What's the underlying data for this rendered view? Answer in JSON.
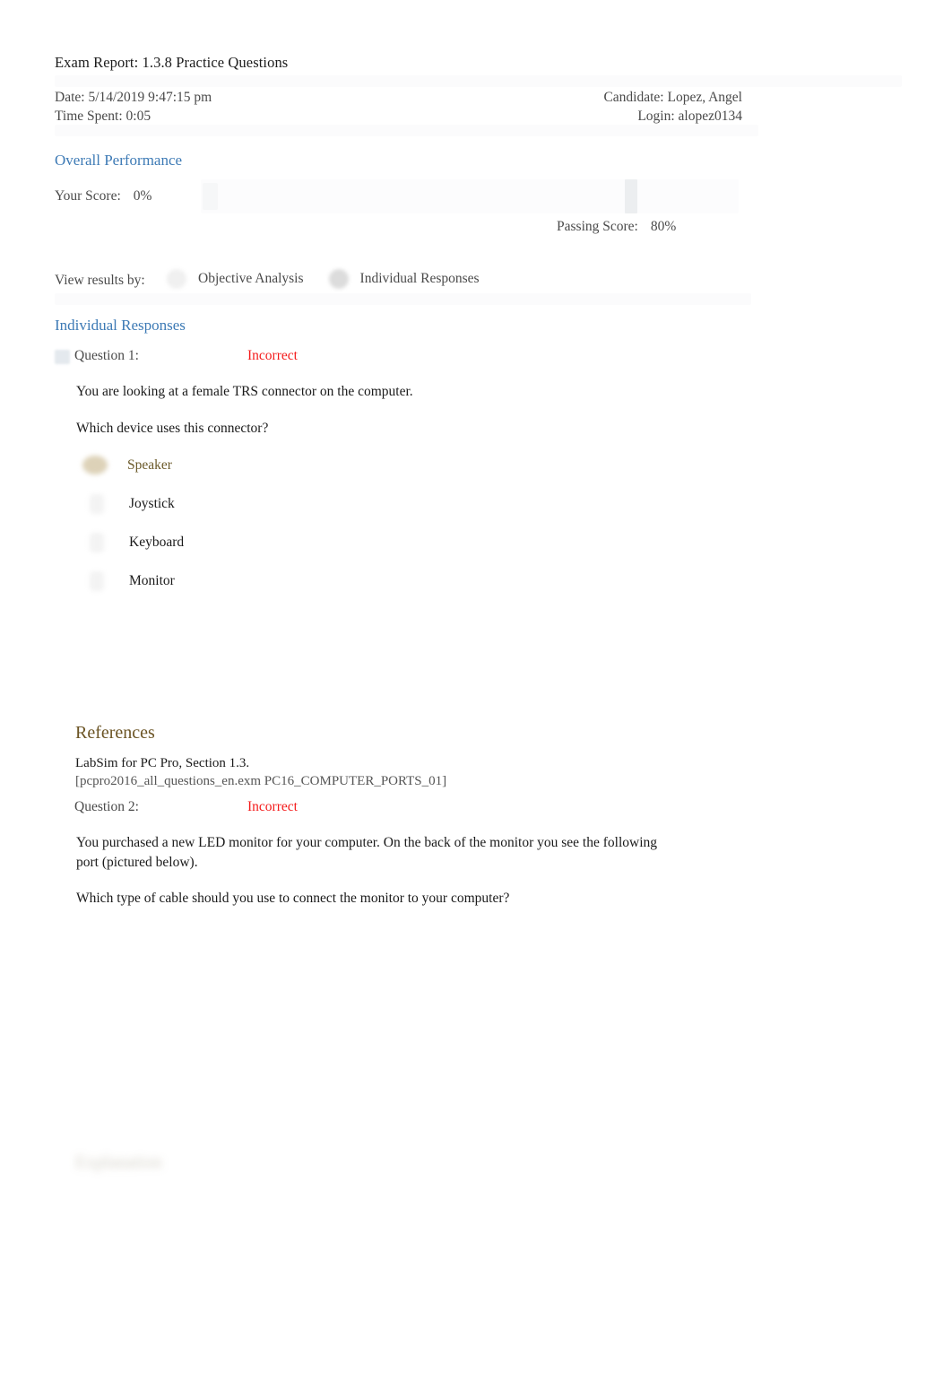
{
  "report": {
    "title": "Exam Report: 1.3.8 Practice Questions",
    "date_line": "Date: 5/14/2019 9:47:15 pm",
    "time_spent_line": "Time Spent: 0:05",
    "candidate_line": "Candidate: Lopez, Angel",
    "login_line": "Login: alopez0134"
  },
  "overall_performance": {
    "heading": "Overall Performance",
    "your_score_label": "Your Score:",
    "your_score_value": "0%",
    "passing_score_label": "Passing Score:",
    "passing_score_value": "80%",
    "score_percent": 0,
    "passing_percent": 80
  },
  "view_results_by": {
    "label": "View results by:",
    "options": [
      {
        "label": "Objective Analysis",
        "selected": false
      },
      {
        "label": "Individual Responses",
        "selected": true
      }
    ]
  },
  "individual_responses": {
    "heading": "Individual Responses",
    "questions": [
      {
        "label": "Question 1:",
        "status": "Incorrect",
        "paragraphs": [
          "You are looking at a female TRS connector on the computer.",
          "Which device uses this connector?"
        ],
        "options": [
          {
            "text": "Speaker",
            "marked": true
          },
          {
            "text": "Joystick",
            "marked": false
          },
          {
            "text": "Keyboard",
            "marked": false
          },
          {
            "text": "Monitor",
            "marked": false
          }
        ],
        "references": {
          "heading": "References",
          "title": "LabSim for PC Pro, Section 1.3.",
          "code": "[pcpro2016_all_questions_en.exm PC16_COMPUTER_PORTS_01]"
        }
      },
      {
        "label": "Question 2:",
        "status": "Incorrect",
        "paragraphs": [
          "You purchased a new LED monitor for your computer. On the back of the monitor you see the following port (pictured below).",
          "Which type of cable should you use to connect the monitor to your computer?"
        ],
        "explanation_heading": "Explanation"
      }
    ]
  },
  "colors": {
    "heading_blue": "#3d7ab5",
    "status_red": "#f41a1a",
    "references_brown": "#6b5424",
    "highlight_olive": "#6b5a2a"
  }
}
